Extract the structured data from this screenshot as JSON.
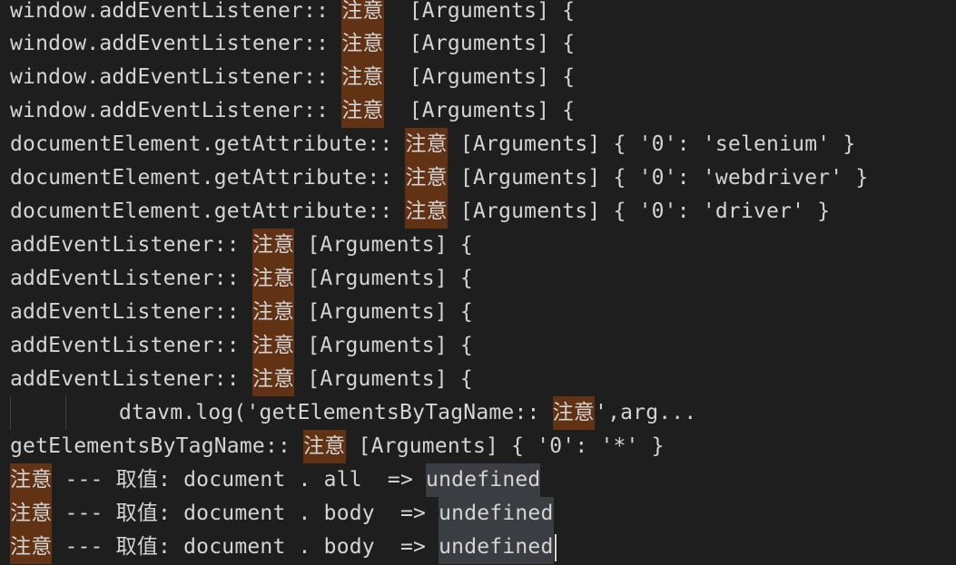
{
  "console": {
    "highlight_word": "注意",
    "lines": [
      {
        "prefix": "window.addEventListener:: ",
        "suffix": "  [Arguments] {"
      },
      {
        "prefix": "window.addEventListener:: ",
        "suffix": "  [Arguments] {"
      },
      {
        "prefix": "window.addEventListener:: ",
        "suffix": "  [Arguments] {"
      },
      {
        "prefix": "window.addEventListener:: ",
        "suffix": "  [Arguments] {"
      },
      {
        "prefix": "documentElement.getAttribute:: ",
        "suffix": " [Arguments] { '0': 'selenium' }"
      },
      {
        "prefix": "documentElement.getAttribute:: ",
        "suffix": " [Arguments] { '0': 'webdriver' }"
      },
      {
        "prefix": "documentElement.getAttribute:: ",
        "suffix": " [Arguments] { '0': 'driver' }"
      },
      {
        "prefix": "addEventListener:: ",
        "suffix": " [Arguments] {"
      },
      {
        "prefix": "addEventListener:: ",
        "suffix": " [Arguments] {"
      },
      {
        "prefix": "addEventListener:: ",
        "suffix": " [Arguments] {"
      },
      {
        "prefix": "addEventListener:: ",
        "suffix": " [Arguments] {"
      },
      {
        "prefix": "addEventListener:: ",
        "suffix": " [Arguments] {"
      }
    ],
    "code_line": {
      "prefix": "dtavm.log('getElementsByTagName:: ",
      "suffix": "',arg..."
    },
    "tag_line": {
      "prefix": "getElementsByTagName:: ",
      "suffix": " [Arguments] { '0': '*' }"
    },
    "value_lines": [
      {
        "middle": " --- 取值: document . all  => ",
        "value": "undefined"
      },
      {
        "middle": " --- 取值: document . body  => ",
        "value": "undefined"
      },
      {
        "middle": " --- 取值: document . body  => ",
        "value": "undefined"
      }
    ]
  }
}
